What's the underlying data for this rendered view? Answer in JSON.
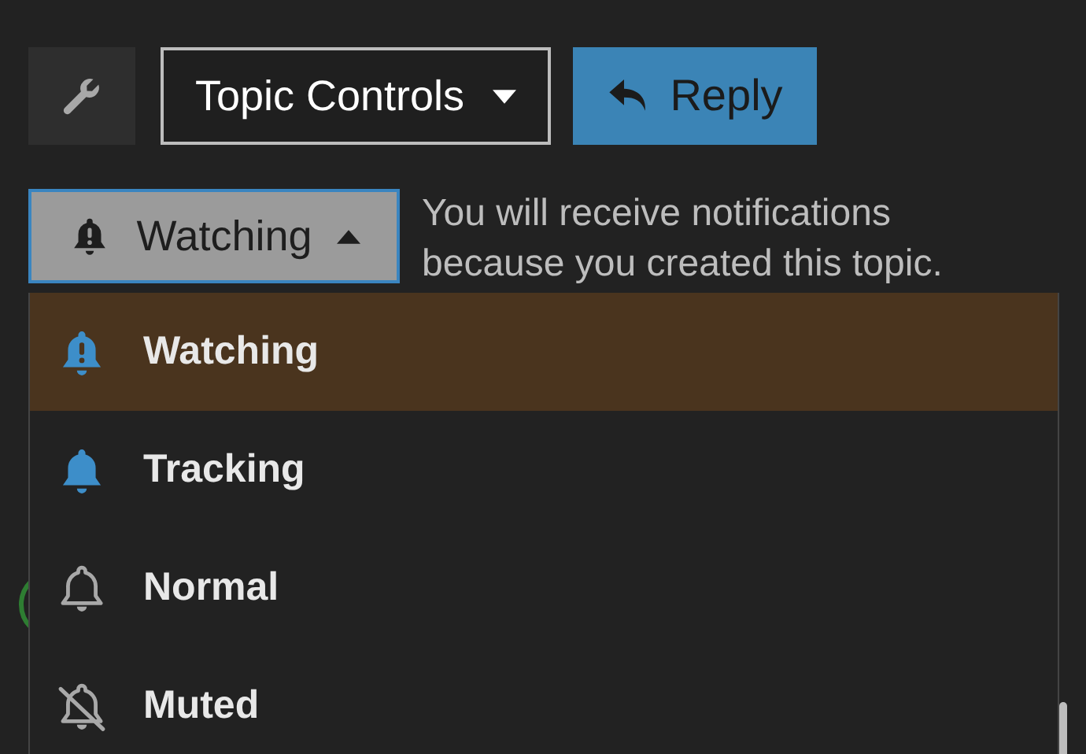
{
  "topic_controls": {
    "label": "Topic Controls"
  },
  "reply_button": {
    "label": "Reply"
  },
  "notification_button": {
    "label": "Watching",
    "kind": "watching",
    "expanded": true
  },
  "notification_description": "You will receive notifications because you created this topic.",
  "notification_levels": [
    {
      "label": "Watching",
      "kind": "watching",
      "selected": true
    },
    {
      "label": "Tracking",
      "kind": "tracking",
      "selected": false
    },
    {
      "label": "Normal",
      "kind": "normal",
      "selected": false
    },
    {
      "label": "Muted",
      "kind": "muted",
      "selected": false
    }
  ]
}
